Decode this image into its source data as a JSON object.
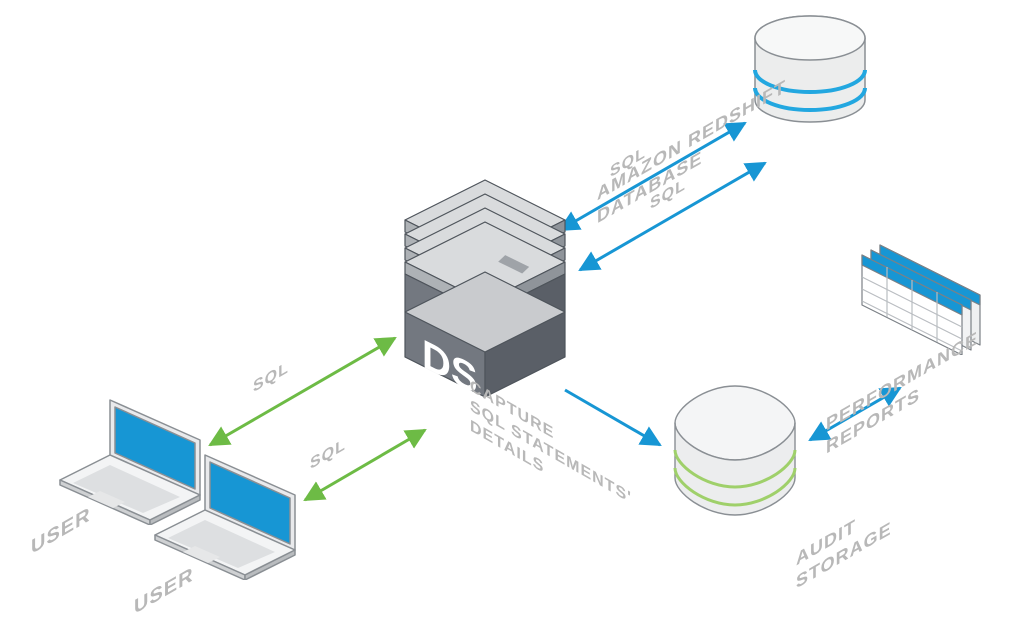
{
  "nodes": {
    "user1": {
      "label": "USER"
    },
    "user2": {
      "label": "USER"
    },
    "ds": {
      "label": "DS"
    },
    "redshift": {
      "label": "AMAZON REDSHIFT\nDATABASE"
    },
    "reports": {
      "label": "PERFORMANCE\nREPORTS"
    },
    "audit": {
      "label": "AUDIT\nSTORAGE"
    }
  },
  "edges": {
    "user1_ds": {
      "label": "SQL"
    },
    "user2_ds": {
      "label": "SQL"
    },
    "ds_redshift_top": {
      "label": "SQL"
    },
    "ds_redshift_bot": {
      "label": "SQL"
    },
    "ds_audit": {
      "label": "CAPTURE\nSQL STATEMENTS'\nDETAILS"
    },
    "audit_reports": {
      "label": ""
    }
  },
  "colors": {
    "green": "#6dbb45",
    "blue": "#1796d4",
    "lightBlue": "#22a7e0",
    "greyStroke": "#6d6d6d",
    "greyFill": "#9aa0a6",
    "greyDark": "#5c626a",
    "offWhite": "#f0f1f2",
    "textGrey": "#b8b8b8"
  }
}
